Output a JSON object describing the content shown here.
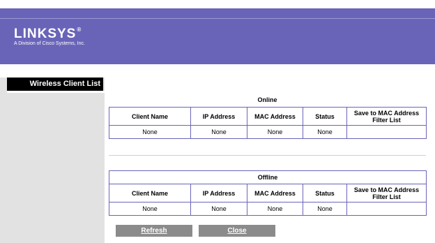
{
  "brand": {
    "logo_text": "LINKSYS",
    "registered": "®",
    "tagline": "A Division of Cisco Systems, Inc."
  },
  "sidebar": {
    "title": "Wireless Client List"
  },
  "columns": [
    "Client Name",
    "IP Address",
    "MAC Address",
    "Status",
    "Save to MAC Address Filter List"
  ],
  "online": {
    "title": "Online",
    "rows": [
      {
        "client_name": "None",
        "ip": "None",
        "mac": "None",
        "status": "None",
        "save": ""
      }
    ]
  },
  "offline": {
    "title": "Offline",
    "rows": [
      {
        "client_name": "None",
        "ip": "None",
        "mac": "None",
        "status": "None",
        "save": ""
      }
    ]
  },
  "buttons": {
    "refresh": "Refresh",
    "close": "Close"
  },
  "colors": {
    "header": "#6a64b9",
    "border": "#6a64b9",
    "sidebar_bg": "#e2e2e2",
    "button_bg": "#8b8b8b"
  }
}
